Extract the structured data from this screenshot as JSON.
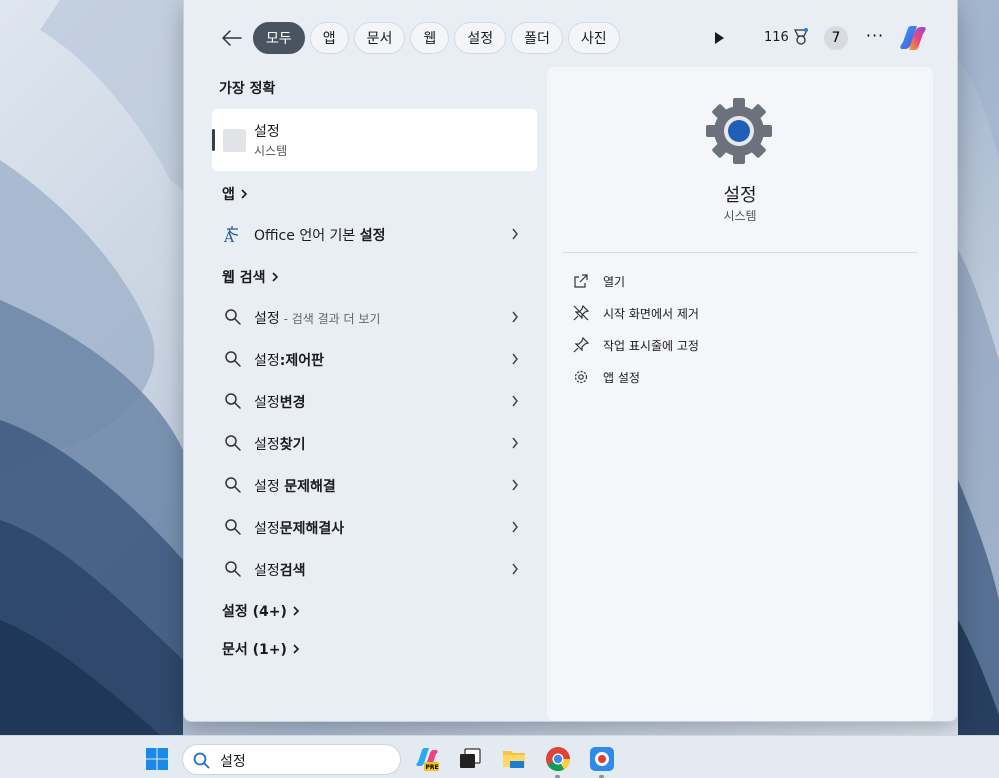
{
  "top_bar": {
    "filters": [
      {
        "label": "모두",
        "active": true
      },
      {
        "label": "앱",
        "active": false
      },
      {
        "label": "문서",
        "active": false
      },
      {
        "label": "웹",
        "active": false
      },
      {
        "label": "설정",
        "active": false
      },
      {
        "label": "폴더",
        "active": false
      },
      {
        "label": "사진",
        "active": false
      }
    ],
    "points": "116",
    "badge_count": "7",
    "more": "···"
  },
  "left": {
    "best_match_title": "가장 정확",
    "best_match": {
      "name": "설정",
      "sub": "시스템"
    },
    "apps_header": "앱",
    "app_item": {
      "prefix": "Office 언어 기본 ",
      "bold": "설정"
    },
    "web_header": "웹 검색",
    "web_items": [
      {
        "plain": "설정",
        "bold": "",
        "hint": " - 검색 결과 더 보기"
      },
      {
        "plain": "설정",
        "bold": ":제어판",
        "hint": ""
      },
      {
        "plain": "설정",
        "bold": "변경",
        "hint": ""
      },
      {
        "plain": "설정",
        "bold": "찾기",
        "hint": ""
      },
      {
        "plain": "설정 ",
        "bold": "문제해결",
        "hint": ""
      },
      {
        "plain": "설정",
        "bold": "문제해결사",
        "hint": ""
      },
      {
        "plain": "설정",
        "bold": "검색",
        "hint": ""
      }
    ],
    "settings_more": "설정 (4+)",
    "docs_more": "문서 (1+)"
  },
  "right": {
    "title": "설정",
    "subtitle": "시스템",
    "actions": [
      {
        "label": "열기",
        "icon": "open-external-icon"
      },
      {
        "label": "시작 화면에서 제거",
        "icon": "unpin-icon"
      },
      {
        "label": "작업 표시줄에 고정",
        "icon": "pin-icon"
      },
      {
        "label": "앱 설정",
        "icon": "gear-icon"
      }
    ]
  },
  "taskbar": {
    "search_value": "설정"
  },
  "colors": {
    "chip_active": "#4a5360",
    "gear_blue": "#1f5fb7",
    "gear_gray": "#6b727b"
  }
}
